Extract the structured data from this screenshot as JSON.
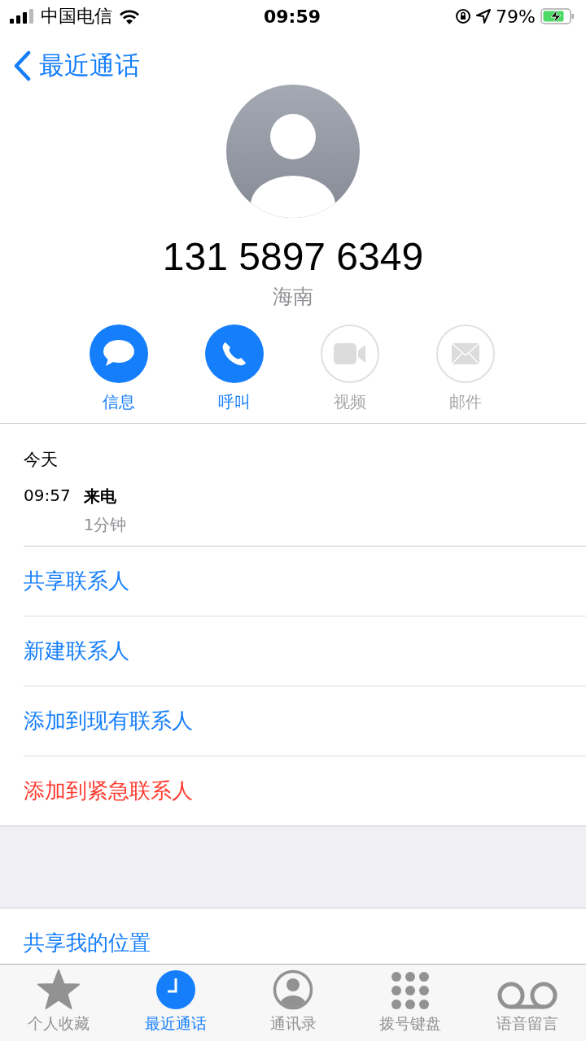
{
  "status_bar": {
    "carrier": "中国电信",
    "time": "09:59",
    "battery": "79%"
  },
  "nav": {
    "back": "最近通话"
  },
  "contact": {
    "number": "131 5897 6349",
    "region": "海南"
  },
  "actions": [
    {
      "kind": "message",
      "label": "信息",
      "disabled": false
    },
    {
      "kind": "call",
      "label": "呼叫",
      "disabled": false
    },
    {
      "kind": "video",
      "label": "视频",
      "disabled": true
    },
    {
      "kind": "mail",
      "label": "邮件",
      "disabled": true
    }
  ],
  "history": {
    "day": "今天",
    "calls": [
      {
        "time": "09:57",
        "type": "来电",
        "duration": "1分钟"
      }
    ]
  },
  "options": [
    {
      "kind": "normal",
      "label": "共享联系人"
    },
    {
      "kind": "normal",
      "label": "新建联系人"
    },
    {
      "kind": "normal",
      "label": "添加到现有联系人"
    },
    {
      "kind": "destructive",
      "label": "添加到紧急联系人"
    }
  ],
  "extra_options": [
    {
      "kind": "normal",
      "label": "共享我的位置"
    }
  ],
  "tabs": [
    {
      "kind": "favorites",
      "label": "个人收藏",
      "selected": false
    },
    {
      "kind": "recents",
      "label": "最近通话",
      "selected": true
    },
    {
      "kind": "contacts",
      "label": "通讯录",
      "selected": false
    },
    {
      "kind": "keypad",
      "label": "拨号键盘",
      "selected": false
    },
    {
      "kind": "voicemail",
      "label": "语音留言",
      "selected": false
    }
  ]
}
